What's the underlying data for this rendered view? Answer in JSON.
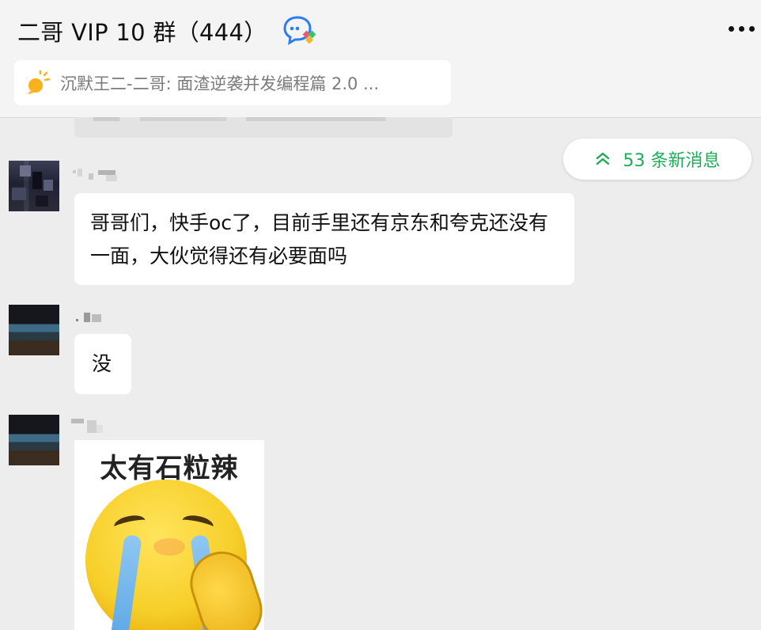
{
  "header": {
    "title": "二哥 VIP 10 群（444）",
    "chat_icon": "chat-bubble-icon",
    "more_icon": "more-dots-icon"
  },
  "pinned": {
    "icon": "bulb-icon",
    "text": "沉默王二-二哥: 面渣逆袭并发编程篇 2.0 ..."
  },
  "new_messages": {
    "icon": "double-chevron-up-icon",
    "label": "53 条新消息",
    "color": "#1aad55"
  },
  "messages": [
    {
      "type": "text",
      "text": "哥哥们，快手oc了，目前手里还有京东和夸克还没有一面，大伙觉得还有必要面吗"
    },
    {
      "type": "text",
      "text": "没"
    },
    {
      "type": "sticker",
      "caption": "太有石粒辣",
      "icon": "crying-face-sticker"
    }
  ],
  "colors": {
    "background": "#ededed",
    "bubble": "#ffffff",
    "accent_green": "#1aad55"
  }
}
